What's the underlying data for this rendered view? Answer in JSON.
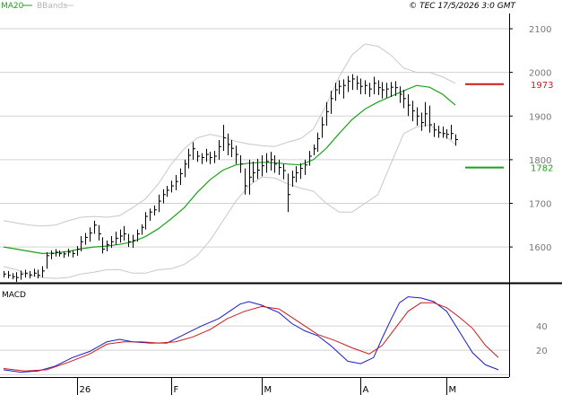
{
  "header": {
    "left": [
      "MA20",
      "BBands"
    ],
    "right": "© TEC 17/5/2026 3:0 GMT"
  },
  "colors": {
    "price": "#000000",
    "ma": "#19a319",
    "bands": "#c8c8c8",
    "macd": "#1a1acc",
    "signal": "#cc1a1a",
    "resistance": "#cc1a1a",
    "support": "#19a319",
    "grid": "#d2d2d2",
    "frame": "#000000",
    "label": "#777777"
  },
  "chart_data": [
    {
      "type": "ohlc",
      "name": "price",
      "ylim": [
        1520,
        2135
      ],
      "yticks": [
        1600,
        1700,
        1800,
        1900,
        2000,
        2100
      ],
      "months": [
        {
          "label": "26",
          "i": 17
        },
        {
          "label": "F",
          "i": 39
        },
        {
          "label": "M",
          "i": 60
        },
        {
          "label": "A",
          "i": 83
        },
        {
          "label": "M",
          "i": 103
        }
      ],
      "bars": [
        [
          1545,
          1530,
          1538
        ],
        [
          1545,
          1528,
          1535
        ],
        [
          1540,
          1526,
          1532
        ],
        [
          1542,
          1520,
          1530
        ],
        [
          1546,
          1525,
          1538
        ],
        [
          1548,
          1530,
          1540
        ],
        [
          1545,
          1528,
          1536
        ],
        [
          1550,
          1532,
          1540
        ],
        [
          1548,
          1528,
          1535
        ],
        [
          1556,
          1530,
          1545
        ],
        [
          1588,
          1550,
          1580
        ],
        [
          1592,
          1572,
          1585
        ],
        [
          1595,
          1578,
          1588
        ],
        [
          1592,
          1578,
          1585
        ],
        [
          1590,
          1575,
          1584
        ],
        [
          1596,
          1578,
          1588
        ],
        [
          1592,
          1576,
          1585
        ],
        [
          1602,
          1580,
          1595
        ],
        [
          1625,
          1590,
          1612
        ],
        [
          1632,
          1605,
          1622
        ],
        [
          1645,
          1612,
          1632
        ],
        [
          1660,
          1630,
          1650
        ],
        [
          1650,
          1615,
          1630
        ],
        [
          1622,
          1585,
          1595
        ],
        [
          1615,
          1590,
          1605
        ],
        [
          1625,
          1598,
          1612
        ],
        [
          1635,
          1605,
          1620
        ],
        [
          1640,
          1610,
          1625
        ],
        [
          1648,
          1615,
          1630
        ],
        [
          1630,
          1600,
          1612
        ],
        [
          1628,
          1598,
          1615
        ],
        [
          1640,
          1612,
          1630
        ],
        [
          1652,
          1628,
          1645
        ],
        [
          1680,
          1640,
          1670
        ],
        [
          1688,
          1660,
          1680
        ],
        [
          1695,
          1672,
          1685
        ],
        [
          1720,
          1680,
          1705
        ],
        [
          1732,
          1700,
          1720
        ],
        [
          1740,
          1715,
          1730
        ],
        [
          1752,
          1725,
          1740
        ],
        [
          1765,
          1730,
          1750
        ],
        [
          1780,
          1742,
          1768
        ],
        [
          1800,
          1760,
          1790
        ],
        [
          1825,
          1780,
          1810
        ],
        [
          1840,
          1800,
          1825
        ],
        [
          1820,
          1795,
          1808
        ],
        [
          1815,
          1790,
          1805
        ],
        [
          1825,
          1795,
          1812
        ],
        [
          1818,
          1790,
          1805
        ],
        [
          1820,
          1792,
          1808
        ],
        [
          1845,
          1800,
          1830
        ],
        [
          1880,
          1820,
          1850
        ],
        [
          1860,
          1810,
          1835
        ],
        [
          1845,
          1806,
          1826
        ],
        [
          1832,
          1790,
          1812
        ],
        [
          1810,
          1770,
          1790
        ],
        [
          1780,
          1720,
          1740
        ],
        [
          1800,
          1720,
          1760
        ],
        [
          1796,
          1748,
          1770
        ],
        [
          1802,
          1756,
          1776
        ],
        [
          1810,
          1762,
          1786
        ],
        [
          1815,
          1770,
          1796
        ],
        [
          1818,
          1775,
          1800
        ],
        [
          1810,
          1770,
          1790
        ],
        [
          1800,
          1765,
          1782
        ],
        [
          1790,
          1755,
          1775
        ],
        [
          1768,
          1680,
          1720
        ],
        [
          1775,
          1738,
          1760
        ],
        [
          1785,
          1748,
          1770
        ],
        [
          1792,
          1756,
          1780
        ],
        [
          1800,
          1765,
          1788
        ],
        [
          1820,
          1786,
          1808
        ],
        [
          1835,
          1810,
          1825
        ],
        [
          1862,
          1818,
          1848
        ],
        [
          1898,
          1850,
          1880
        ],
        [
          1932,
          1878,
          1910
        ],
        [
          1958,
          1905,
          1940
        ],
        [
          1976,
          1935,
          1960
        ],
        [
          1982,
          1950,
          1968
        ],
        [
          1984,
          1940,
          1970
        ],
        [
          1992,
          1955,
          1980
        ],
        [
          1996,
          1960,
          1985
        ],
        [
          1992,
          1960,
          1975
        ],
        [
          1986,
          1950,
          1968
        ],
        [
          1982,
          1950,
          1970
        ],
        [
          1976,
          1944,
          1962
        ],
        [
          1990,
          1950,
          1975
        ],
        [
          1982,
          1948,
          1965
        ],
        [
          1978,
          1940,
          1960
        ],
        [
          1976,
          1942,
          1962
        ],
        [
          1978,
          1944,
          1966
        ],
        [
          1980,
          1946,
          1965
        ],
        [
          1968,
          1930,
          1950
        ],
        [
          1960,
          1918,
          1940
        ],
        [
          1950,
          1900,
          1925
        ],
        [
          1935,
          1888,
          1912
        ],
        [
          1920,
          1878,
          1900
        ],
        [
          1908,
          1866,
          1885
        ],
        [
          1932,
          1876,
          1905
        ],
        [
          1924,
          1862,
          1880
        ],
        [
          1884,
          1852,
          1868
        ],
        [
          1878,
          1850,
          1862
        ],
        [
          1876,
          1850,
          1860
        ],
        [
          1870,
          1848,
          1858
        ],
        [
          1880,
          1846,
          1860
        ],
        [
          1858,
          1832,
          1846
        ]
      ],
      "ma20": [
        [
          0,
          1600
        ],
        [
          3,
          1595
        ],
        [
          6,
          1590
        ],
        [
          9,
          1585
        ],
        [
          12,
          1586
        ],
        [
          15,
          1590
        ],
        [
          18,
          1596
        ],
        [
          21,
          1600
        ],
        [
          24,
          1602
        ],
        [
          27,
          1606
        ],
        [
          30,
          1612
        ],
        [
          33,
          1624
        ],
        [
          36,
          1642
        ],
        [
          39,
          1665
        ],
        [
          42,
          1690
        ],
        [
          45,
          1725
        ],
        [
          48,
          1754
        ],
        [
          51,
          1776
        ],
        [
          54,
          1788
        ],
        [
          57,
          1792
        ],
        [
          60,
          1794
        ],
        [
          63,
          1793
        ],
        [
          66,
          1790
        ],
        [
          69,
          1788
        ],
        [
          72,
          1800
        ],
        [
          75,
          1826
        ],
        [
          78,
          1860
        ],
        [
          81,
          1892
        ],
        [
          84,
          1916
        ],
        [
          87,
          1932
        ],
        [
          90,
          1945
        ],
        [
          93,
          1958
        ],
        [
          96,
          1970
        ],
        [
          99,
          1966
        ],
        [
          102,
          1950
        ],
        [
          105,
          1925
        ]
      ],
      "band_upper": [
        [
          0,
          1660
        ],
        [
          3,
          1655
        ],
        [
          6,
          1650
        ],
        [
          9,
          1648
        ],
        [
          12,
          1650
        ],
        [
          15,
          1660
        ],
        [
          18,
          1668
        ],
        [
          21,
          1670
        ],
        [
          24,
          1668
        ],
        [
          27,
          1672
        ],
        [
          30,
          1690
        ],
        [
          33,
          1710
        ],
        [
          36,
          1745
        ],
        [
          39,
          1790
        ],
        [
          42,
          1825
        ],
        [
          45,
          1850
        ],
        [
          48,
          1858
        ],
        [
          51,
          1852
        ],
        [
          54,
          1842
        ],
        [
          57,
          1836
        ],
        [
          60,
          1832
        ],
        [
          63,
          1830
        ],
        [
          66,
          1840
        ],
        [
          69,
          1848
        ],
        [
          72,
          1870
        ],
        [
          75,
          1925
        ],
        [
          78,
          1990
        ],
        [
          81,
          2040
        ],
        [
          84,
          2065
        ],
        [
          87,
          2060
        ],
        [
          90,
          2040
        ],
        [
          93,
          2010
        ],
        [
          96,
          2000
        ],
        [
          99,
          2000
        ],
        [
          102,
          1990
        ],
        [
          105,
          1975
        ]
      ],
      "band_lower": [
        [
          0,
          1555
        ],
        [
          3,
          1548
        ],
        [
          6,
          1535
        ],
        [
          9,
          1530
        ],
        [
          12,
          1528
        ],
        [
          15,
          1530
        ],
        [
          18,
          1538
        ],
        [
          21,
          1542
        ],
        [
          24,
          1548
        ],
        [
          27,
          1548
        ],
        [
          30,
          1540
        ],
        [
          33,
          1540
        ],
        [
          36,
          1548
        ],
        [
          39,
          1550
        ],
        [
          42,
          1560
        ],
        [
          45,
          1580
        ],
        [
          48,
          1615
        ],
        [
          51,
          1660
        ],
        [
          54,
          1705
        ],
        [
          57,
          1740
        ],
        [
          60,
          1760
        ],
        [
          63,
          1758
        ],
        [
          66,
          1745
        ],
        [
          69,
          1735
        ],
        [
          72,
          1728
        ],
        [
          75,
          1700
        ],
        [
          78,
          1680
        ],
        [
          81,
          1680
        ],
        [
          84,
          1700
        ],
        [
          87,
          1720
        ],
        [
          90,
          1790
        ],
        [
          93,
          1860
        ],
        [
          96,
          1875
        ],
        [
          99,
          1880
        ],
        [
          102,
          1860
        ],
        [
          105,
          1835
        ]
      ],
      "levels": [
        {
          "value": 1973,
          "label": "1973",
          "role": "resistance"
        },
        {
          "value": 1782,
          "label": "1782",
          "role": "support"
        }
      ]
    },
    {
      "type": "line",
      "name": "MACD",
      "ylim": [
        -2,
        74
      ],
      "yticks": [
        20,
        40
      ],
      "series": [
        {
          "key": "macd",
          "values": [
            [
              0,
              4
            ],
            [
              4,
              2
            ],
            [
              8,
              3
            ],
            [
              12,
              7
            ],
            [
              16,
              14
            ],
            [
              20,
              19
            ],
            [
              24,
              27
            ],
            [
              27,
              29
            ],
            [
              30,
              27
            ],
            [
              34,
              26
            ],
            [
              38,
              26
            ],
            [
              42,
              33
            ],
            [
              46,
              40
            ],
            [
              50,
              46
            ],
            [
              55,
              58
            ],
            [
              57,
              60
            ],
            [
              60,
              57
            ],
            [
              64,
              51
            ],
            [
              67,
              42
            ],
            [
              70,
              36
            ],
            [
              73,
              32
            ],
            [
              76,
              24
            ],
            [
              80,
              11
            ],
            [
              83,
              9
            ],
            [
              86,
              14
            ],
            [
              88,
              30
            ],
            [
              90,
              45
            ],
            [
              92,
              59
            ],
            [
              94,
              64
            ],
            [
              97,
              63
            ],
            [
              100,
              60
            ],
            [
              103,
              52
            ],
            [
              106,
              35
            ],
            [
              109,
              18
            ],
            [
              112,
              8
            ],
            [
              115,
              4
            ]
          ]
        },
        {
          "key": "signal",
          "values": [
            [
              0,
              5
            ],
            [
              5,
              3
            ],
            [
              10,
              4
            ],
            [
              15,
              10
            ],
            [
              20,
              17
            ],
            [
              24,
              25
            ],
            [
              28,
              27
            ],
            [
              32,
              27
            ],
            [
              36,
              26
            ],
            [
              40,
              27
            ],
            [
              44,
              31
            ],
            [
              48,
              37
            ],
            [
              52,
              46
            ],
            [
              56,
              52
            ],
            [
              60,
              56
            ],
            [
              64,
              54
            ],
            [
              67,
              47
            ],
            [
              70,
              40
            ],
            [
              73,
              33
            ],
            [
              77,
              28
            ],
            [
              81,
              22
            ],
            [
              85,
              17
            ],
            [
              88,
              24
            ],
            [
              91,
              38
            ],
            [
              94,
              52
            ],
            [
              97,
              59
            ],
            [
              100,
              59
            ],
            [
              103,
              55
            ],
            [
              106,
              47
            ],
            [
              109,
              38
            ],
            [
              112,
              24
            ],
            [
              115,
              14
            ]
          ]
        }
      ]
    }
  ],
  "macd_label": "MACD"
}
